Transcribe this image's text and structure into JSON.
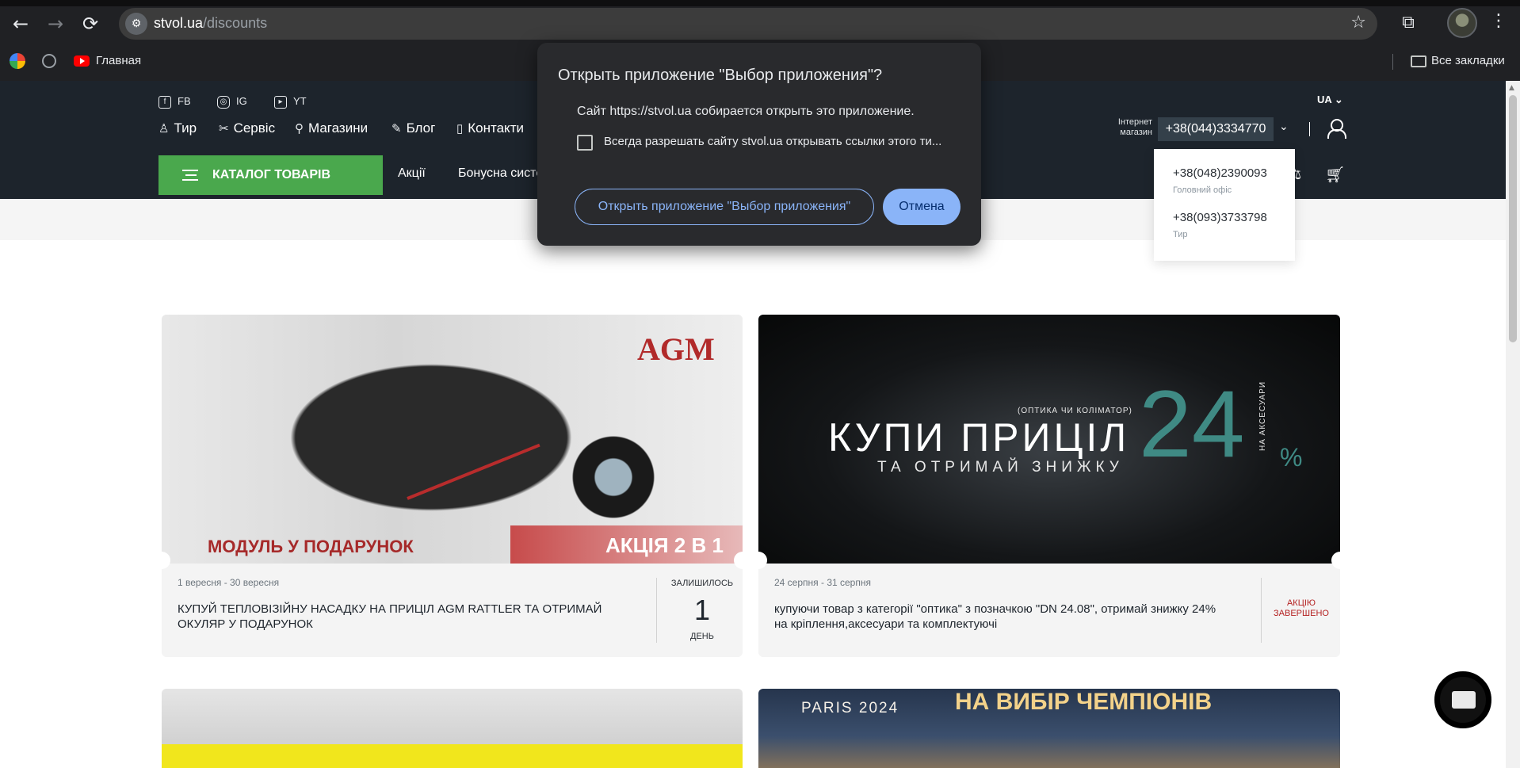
{
  "browser": {
    "url_host": "stvol.ua",
    "url_path": "/discounts",
    "bookmarks": [
      {
        "label": "Главная"
      }
    ],
    "all_bookmarks_label": "Все закладки",
    "icons": {
      "back": "←",
      "forward": "→",
      "reload": "⟳",
      "site_settings": "⚙",
      "star": "☆",
      "extensions": "⧉",
      "kebab": "⋮"
    }
  },
  "header": {
    "social": [
      {
        "label": "FB"
      },
      {
        "label": "IG"
      },
      {
        "label": "YT"
      }
    ],
    "nav": [
      {
        "label": "Тир",
        "icon": "target-icon"
      },
      {
        "label": "Сервіс",
        "icon": "tools-icon"
      },
      {
        "label": "Магазини",
        "icon": "map-pin-icon"
      },
      {
        "label": "Блог",
        "icon": "pen-icon"
      },
      {
        "label": "Контакти",
        "icon": "phone-icon"
      }
    ],
    "lang": "UA",
    "shop_label_1": "Інтернет",
    "shop_label_2": "магазин",
    "phone_main": "+38(044)3334770",
    "catalog_button": "КАТАЛОГ ТОВАРІВ",
    "menu": [
      {
        "label": "Акції"
      },
      {
        "label": "Бонусна систе"
      }
    ],
    "phone_dropdown": [
      {
        "number": "+38(048)2390093",
        "label": "Головний офіс"
      },
      {
        "number": "+38(093)3733798",
        "label": "Тир"
      }
    ]
  },
  "dialog": {
    "title": "Открыть приложение \"Выбор приложения\"?",
    "text": "Сайт https://stvol.ua собирается открыть это приложение.",
    "checkbox_label": "Всегда разрешать сайту stvol.ua открывать ссылки этого ти...",
    "open_button": "Открыть приложение \"Выбор приложения\"",
    "cancel_button": "Отмена"
  },
  "promotions": [
    {
      "dates": "1 вересня - 30 вересня",
      "title": "КУПУЙ ТЕПЛОВІЗІЙНУ НАСАДКУ НА ПРИЦІЛ AGM RATTLER ТА ОТРИМАЙ ОКУЛЯР У ПОДАРУНОК",
      "status_label": "ЗАЛИШИЛОСЬ",
      "status_value": "1",
      "status_unit": "ДЕНЬ",
      "banner": {
        "brand": "AGM",
        "left_text": "МОДУЛЬ У ПОДАРУНОК",
        "right_text": "АКЦІЯ 2 В 1"
      }
    },
    {
      "dates": "24 серпня - 31 серпня",
      "title": "купуючи товар з категорії \"оптика\" з позначкою \"DN 24.08\", отримай знижку 24% на кріплення,аксесуари та комплектуючі",
      "status_ended_1": "АКЦІЮ",
      "status_ended_2": "ЗАВЕРШЕНО",
      "banner": {
        "headline": "КУПИ ПРИЦІЛ",
        "subline": "ТА ОТРИМАЙ ЗНИЖКУ",
        "small": "(ОПТИКА ЧИ КОЛІМАТОР)",
        "percent": "24",
        "percent_sign": "%",
        "vertical": "НА АКСЕСУАРИ"
      }
    },
    {
      "banner": {}
    },
    {
      "banner": {
        "headline": "НА ВИБІР ЧЕМПІОНІВ",
        "logo": "PARIS 2024"
      }
    }
  ],
  "colors": {
    "chrome_bg": "#202124",
    "header_bg": "#1d242c",
    "catalog_green": "#4aa84d",
    "dialog_bg": "#292a2d",
    "dialog_accent": "#8ab4f8",
    "ended_red": "#b42222",
    "discount_teal": "#3f8a84"
  }
}
